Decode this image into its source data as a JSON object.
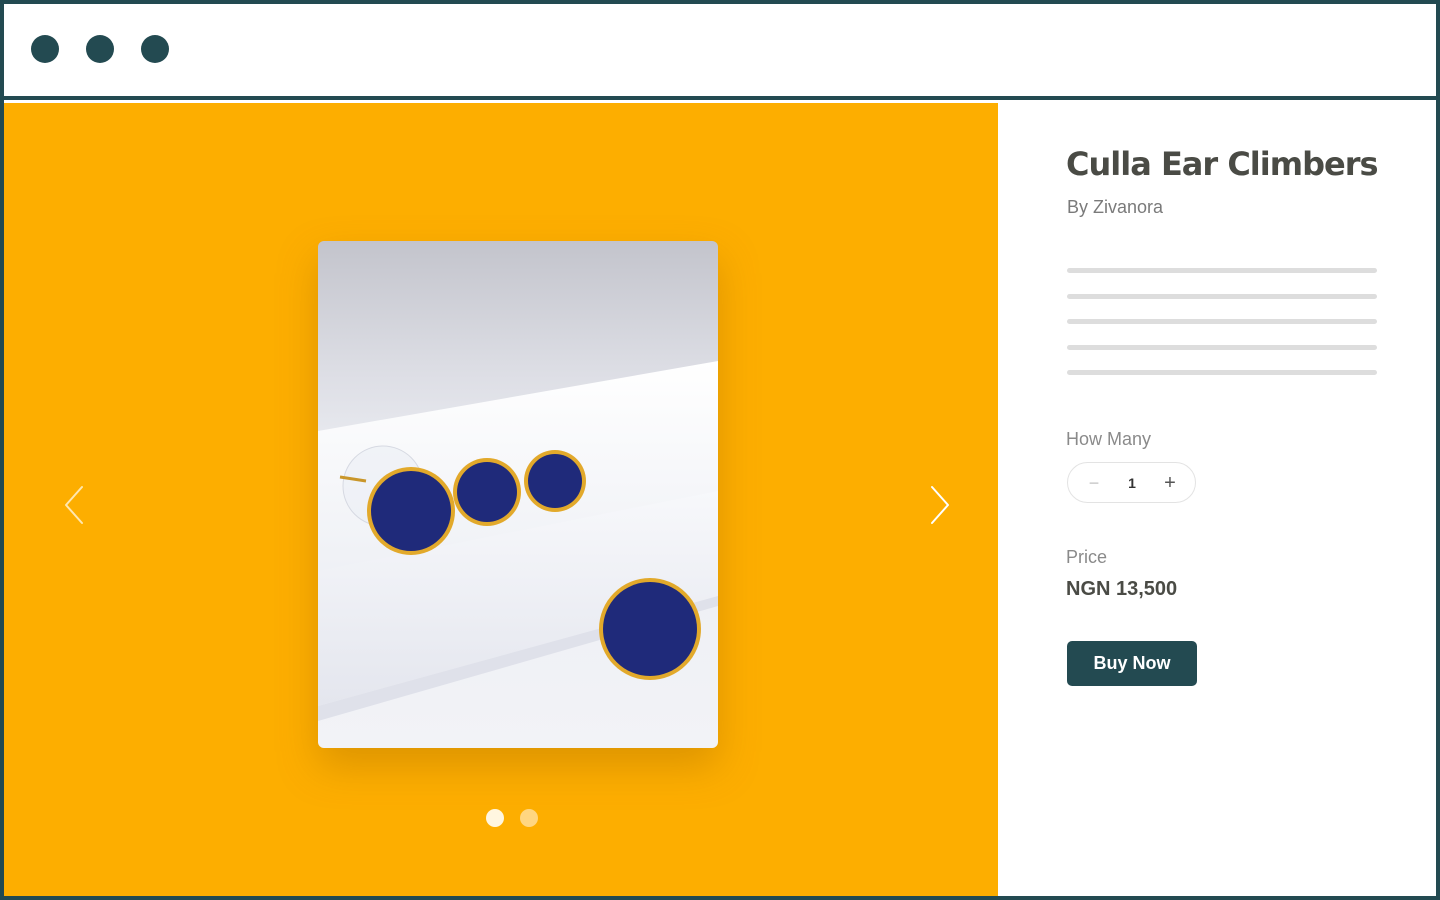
{
  "window": {
    "controls": [
      "window-dot",
      "window-dot",
      "window-dot"
    ]
  },
  "gallery": {
    "background": "#fdae00",
    "prev_icon": "chevron-left-icon",
    "next_icon": "chevron-right-icon",
    "pages": 2,
    "active_page": 1
  },
  "product": {
    "title": "Culla Ear Climbers",
    "byline": "By Zivanora",
    "description_lines": 5,
    "quantity_label": "How Many",
    "quantity_minus": "−",
    "quantity_value": "1",
    "quantity_plus": "+",
    "price_label": "Price",
    "price_value": "NGN 13,500",
    "buy_label": "Buy Now"
  },
  "colors": {
    "accent": "#234a51",
    "gallery_bg": "#fdae00",
    "text_dark": "#4a4b45",
    "text_muted": "#8a8a8a"
  }
}
